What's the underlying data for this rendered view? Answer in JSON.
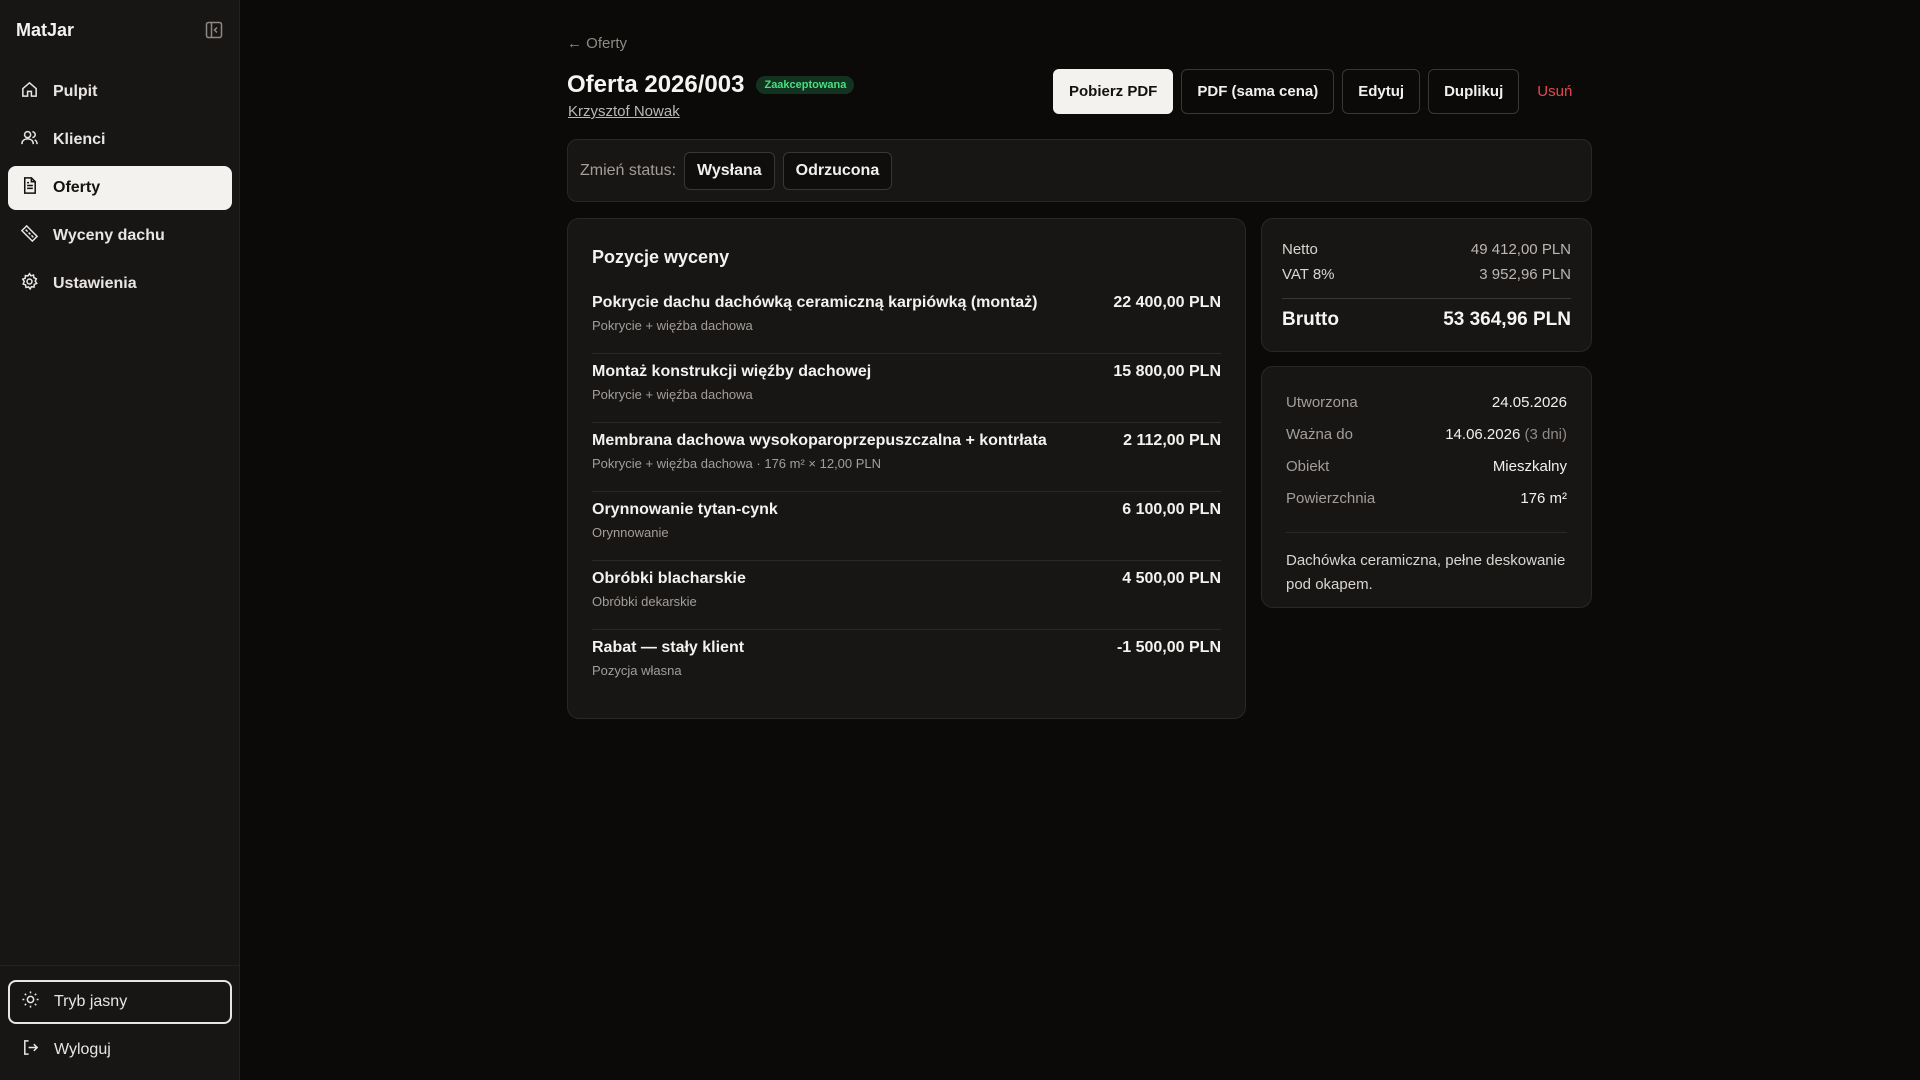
{
  "app": {
    "brand": "MatJar"
  },
  "sidebar": {
    "items": [
      {
        "label": "Pulpit",
        "icon": "home-icon"
      },
      {
        "label": "Klienci",
        "icon": "users-icon"
      },
      {
        "label": "Oferty",
        "icon": "document-icon",
        "active": true
      },
      {
        "label": "Wyceny dachu",
        "icon": "ruler-icon"
      },
      {
        "label": "Ustawienia",
        "icon": "gear-icon"
      }
    ],
    "theme_label": "Tryb jasny",
    "logout_label": "Wyloguj"
  },
  "header": {
    "back_label": "← Oferty",
    "title": "Oferta 2026/003",
    "status_badge": "Zaakceptowana",
    "client": "Krzysztof Nowak"
  },
  "actions": {
    "pdf": "Pobierz PDF",
    "pdf_price": "PDF (sama cena)",
    "edit": "Edytuj",
    "duplicate": "Duplikuj",
    "delete": "Usuń"
  },
  "status_change": {
    "label": "Zmień status:",
    "options": [
      "Wysłana",
      "Odrzucona"
    ]
  },
  "positions": {
    "title": "Pozycje wyceny",
    "items": [
      {
        "name": "Pokrycie dachu dachówką ceramiczną karpiówką (montaż)",
        "sub": "Pokrycie + więźba dachowa",
        "price": "22 400,00 PLN"
      },
      {
        "name": "Montaż konstrukcji więźby dachowej",
        "sub": "Pokrycie + więźba dachowa",
        "price": "15 800,00 PLN"
      },
      {
        "name": "Membrana dachowa wysokoparoprzepuszczalna + kontrłata",
        "sub": "Pokrycie + więźba dachowa · 176 m² × 12,00 PLN",
        "price": "2 112,00 PLN"
      },
      {
        "name": "Orynnowanie tytan-cynk",
        "sub": "Orynnowanie",
        "price": "6 100,00 PLN"
      },
      {
        "name": "Obróbki blacharskie",
        "sub": "Obróbki dekarskie",
        "price": "4 500,00 PLN"
      },
      {
        "name": "Rabat — stały klient",
        "sub": "Pozycja własna",
        "price": "-1 500,00 PLN"
      }
    ]
  },
  "totals": {
    "net_label": "Netto",
    "net_value": "49 412,00 PLN",
    "vat_label": "VAT 8%",
    "vat_value": "3 952,96 PLN",
    "gross_label": "Brutto",
    "gross_value": "53 364,96 PLN"
  },
  "info": {
    "created_label": "Utworzona",
    "created_value": "24.05.2026",
    "valid_label": "Ważna do",
    "valid_value": "14.06.2026",
    "valid_note": "(3 dni)",
    "object_label": "Obiekt",
    "object_value": "Mieszkalny",
    "area_label": "Powierzchnia",
    "area_value": "176 m²",
    "notes": "Dachówka ceramiczna, pełne deskowanie pod okapem."
  },
  "colors": {
    "background": "#0b0a09",
    "sidebar": "#181615",
    "accepted": "#4ade80",
    "danger": "#e5484d"
  }
}
